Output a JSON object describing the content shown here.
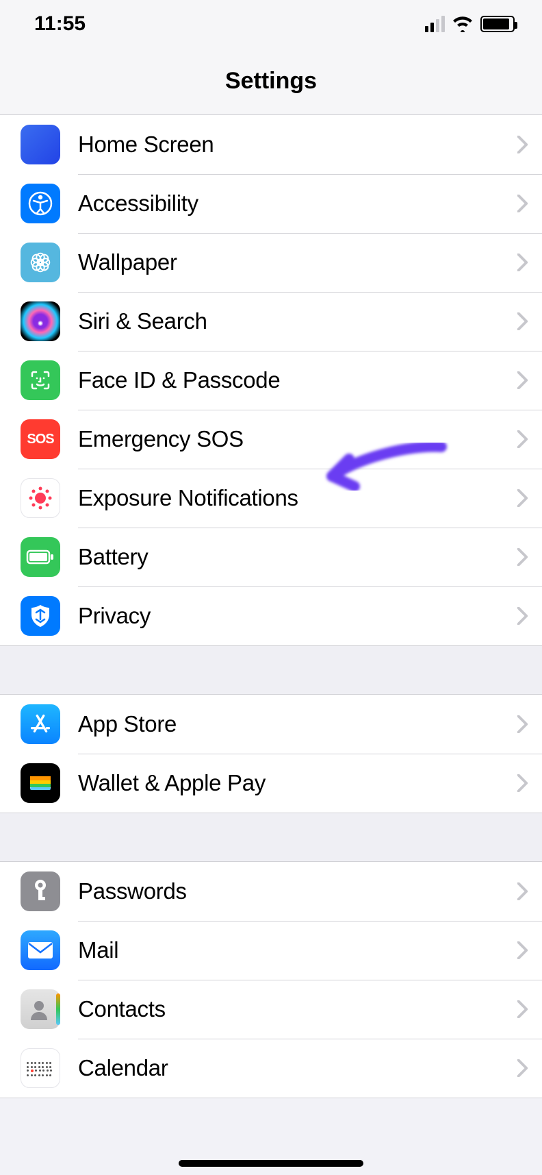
{
  "statusbar": {
    "time": "11:55"
  },
  "nav": {
    "title": "Settings"
  },
  "groups": [
    {
      "id": "g1",
      "rows": [
        {
          "id": "home-screen",
          "label": "Home Screen"
        },
        {
          "id": "accessibility",
          "label": "Accessibility"
        },
        {
          "id": "wallpaper",
          "label": "Wallpaper"
        },
        {
          "id": "siri-search",
          "label": "Siri & Search"
        },
        {
          "id": "faceid",
          "label": "Face ID & Passcode"
        },
        {
          "id": "sos",
          "label": "Emergency SOS",
          "sos_text": "SOS"
        },
        {
          "id": "exposure",
          "label": "Exposure Notifications"
        },
        {
          "id": "battery",
          "label": "Battery"
        },
        {
          "id": "privacy",
          "label": "Privacy"
        }
      ]
    },
    {
      "id": "g2",
      "rows": [
        {
          "id": "app-store",
          "label": "App Store"
        },
        {
          "id": "wallet",
          "label": "Wallet & Apple Pay"
        }
      ]
    },
    {
      "id": "g3",
      "rows": [
        {
          "id": "passwords",
          "label": "Passwords"
        },
        {
          "id": "mail",
          "label": "Mail"
        },
        {
          "id": "contacts",
          "label": "Contacts"
        },
        {
          "id": "calendar",
          "label": "Calendar"
        }
      ]
    }
  ]
}
